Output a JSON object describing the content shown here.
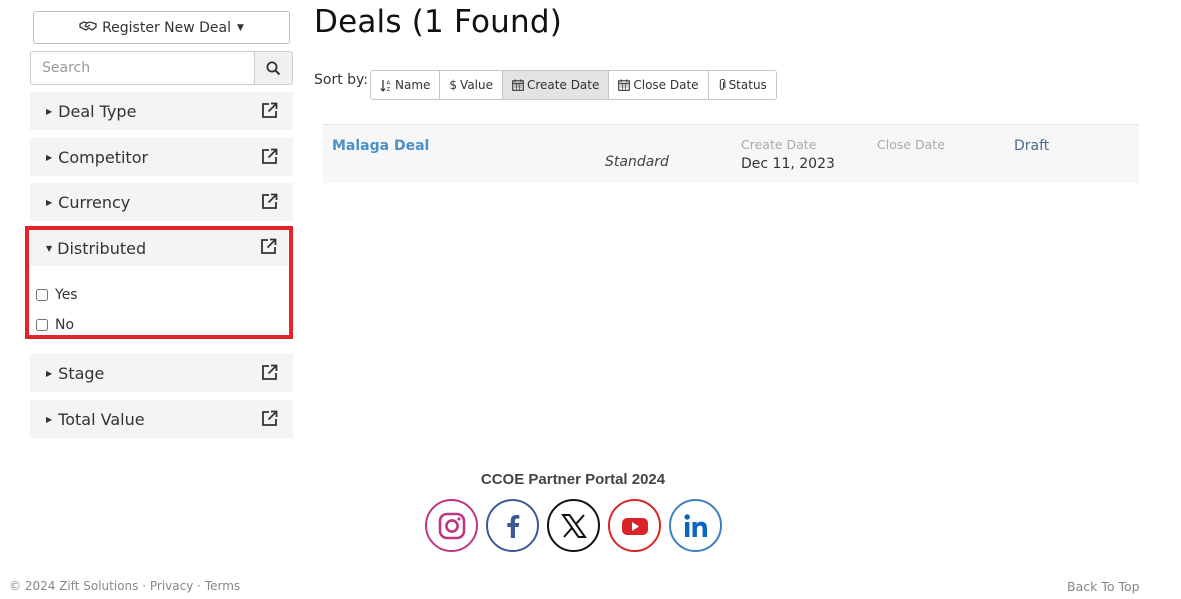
{
  "sidebar": {
    "register_label": "Register New Deal",
    "search_placeholder": "Search",
    "facets": {
      "deal_type": "Deal Type",
      "competitor": "Competitor",
      "currency": "Currency",
      "distributed": "Distributed",
      "stage": "Stage",
      "total_value": "Total Value"
    },
    "distributed_options": [
      "Yes",
      "No"
    ]
  },
  "main": {
    "title": "Deals (1 Found)",
    "sort_label": "Sort by:",
    "sort_options": {
      "name": "Name",
      "value": "Value",
      "value_symbol": "$",
      "create_date": "Create Date",
      "close_date": "Close Date",
      "status": "Status"
    },
    "active_sort": "Create Date",
    "deals": [
      {
        "name": "Malaga Deal",
        "type": "Standard",
        "create_date_label": "Create Date",
        "create_date": "Dec 11, 2023",
        "close_date_label": "Close Date",
        "close_date": "",
        "status": "Draft"
      }
    ]
  },
  "footer": {
    "portal_name": "CCOE Partner Portal 2024",
    "social": [
      "instagram",
      "facebook",
      "x",
      "youtube",
      "linkedin"
    ],
    "copyright": "© 2024 Zift Solutions",
    "privacy": "Privacy",
    "terms": "Terms",
    "separator": "·",
    "back_to_top": "Back To Top"
  },
  "colors": {
    "link": "#4a90c9",
    "highlight_border": "#e3242b",
    "facebook": "#3b5998",
    "youtube": "#d9252a",
    "linkedin": "#0a66c2"
  }
}
